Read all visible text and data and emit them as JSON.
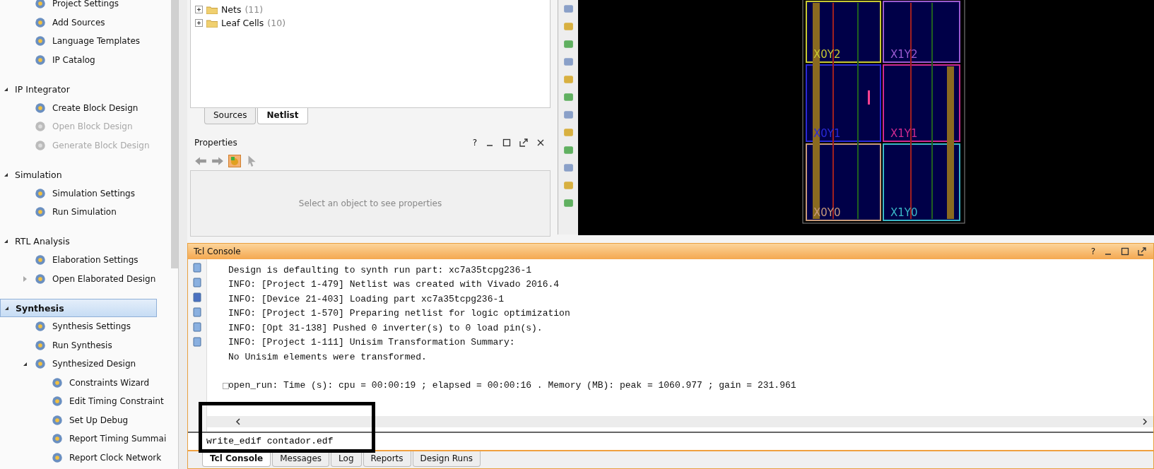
{
  "flow_navigator": {
    "sections": [
      {
        "items": [
          {
            "label": "Project Settings",
            "disabled": false
          },
          {
            "label": "Add Sources",
            "disabled": false
          },
          {
            "label": "Language Templates",
            "disabled": false
          },
          {
            "label": "IP Catalog",
            "disabled": false
          }
        ]
      },
      {
        "title": "IP Integrator",
        "expanded": true,
        "selected": false,
        "items": [
          {
            "label": "Create Block Design",
            "disabled": false
          },
          {
            "label": "Open Block Design",
            "disabled": true
          },
          {
            "label": "Generate Block Design",
            "disabled": true
          }
        ]
      },
      {
        "title": "Simulation",
        "expanded": true,
        "selected": false,
        "items": [
          {
            "label": "Simulation Settings",
            "disabled": false
          },
          {
            "label": "Run Simulation",
            "disabled": false
          }
        ]
      },
      {
        "title": "RTL Analysis",
        "expanded": true,
        "selected": false,
        "items": [
          {
            "label": "Elaboration Settings",
            "disabled": false
          },
          {
            "label": "Open Elaborated Design",
            "disabled": false,
            "expanded": false
          }
        ]
      },
      {
        "title": "Synthesis",
        "expanded": true,
        "selected": true,
        "items": [
          {
            "label": "Synthesis Settings",
            "disabled": false
          },
          {
            "label": "Run Synthesis",
            "disabled": false
          },
          {
            "label": "Synthesized Design",
            "disabled": false,
            "expanded": true,
            "children": [
              {
                "label": "Constraints Wizard",
                "disabled": false
              },
              {
                "label": "Edit Timing Constraint",
                "disabled": false
              },
              {
                "label": "Set Up Debug",
                "disabled": false
              },
              {
                "label": "Report Timing Summai",
                "disabled": false
              },
              {
                "label": "Report Clock Network",
                "disabled": false
              }
            ]
          }
        ]
      }
    ]
  },
  "netlist_tree": [
    {
      "label": "Nets",
      "count": "(11)",
      "expanded": false
    },
    {
      "label": "Leaf Cells",
      "count": "(10)",
      "expanded": false
    }
  ],
  "source_tabs": [
    {
      "label": "Sources",
      "selected": false
    },
    {
      "label": "Netlist",
      "selected": true
    }
  ],
  "properties": {
    "title": "Properties",
    "help": "?",
    "empty_message": "Select an object to see properties"
  },
  "device_view": {
    "clock_regions": [
      {
        "label": "X0Y2",
        "color": "#c8c832"
      },
      {
        "label": "X1Y2",
        "color": "#9a5ad0"
      },
      {
        "label": "X0Y1",
        "color": "#2a2ad8"
      },
      {
        "label": "X1Y1",
        "color": "#d02a90"
      },
      {
        "label": "X0Y0",
        "color": "#c89a7a"
      },
      {
        "label": "X1Y0",
        "color": "#3ab8c8"
      }
    ]
  },
  "tcl_console": {
    "title": "Tcl Console",
    "help": "?",
    "lines": [
      {
        "kind": "output",
        "text": "Design is defaulting to synth run part: xc7a35tcpg236-1"
      },
      {
        "kind": "output",
        "text": "INFO: [Project 1-479] Netlist was created with Vivado 2016.4"
      },
      {
        "kind": "output",
        "text": "INFO: [Device 21-403] Loading part xc7a35tcpg236-1"
      },
      {
        "kind": "output",
        "text": "INFO: [Project 1-570] Preparing netlist for logic optimization"
      },
      {
        "kind": "output",
        "text": "INFO: [Opt 31-138] Pushed 0 inverter(s) to 0 load pin(s)."
      },
      {
        "kind": "output",
        "text": "INFO: [Project 1-111] Unisim Transformation Summary:"
      },
      {
        "kind": "output",
        "text": "No Unisim elements were transformed."
      },
      {
        "kind": "command",
        "text": "open_run: Time (s): cpu = 00:00:19 ; elapsed = 00:00:16 . Memory (MB): peak = 1060.977 ; gain = 231.961"
      }
    ],
    "input_value": "write_edif contador.edf"
  },
  "bottom_tabs": [
    {
      "label": "Tcl Console",
      "selected": true
    },
    {
      "label": "Messages",
      "selected": false
    },
    {
      "label": "Log",
      "selected": false
    },
    {
      "label": "Reports",
      "selected": false
    },
    {
      "label": "Design Runs",
      "selected": false
    }
  ]
}
